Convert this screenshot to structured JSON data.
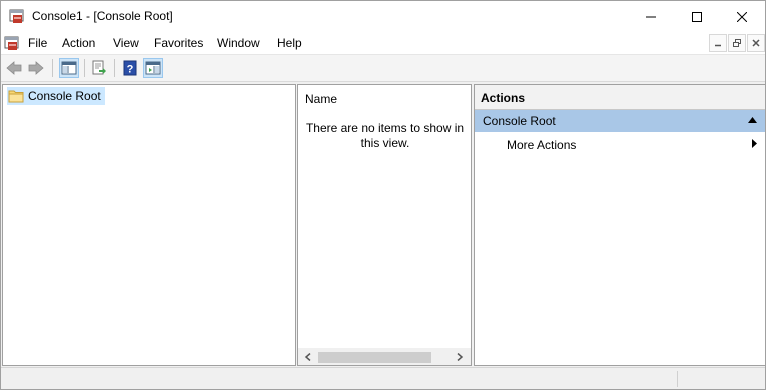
{
  "window": {
    "title": "Console1 - [Console Root]"
  },
  "caption_buttons": {
    "minimize": "minimize-icon",
    "maximize": "maximize-icon",
    "close": "close-icon"
  },
  "menu": {
    "items": [
      {
        "label": "File"
      },
      {
        "label": "Action"
      },
      {
        "label": "View"
      },
      {
        "label": "Favorites"
      },
      {
        "label": "Window"
      },
      {
        "label": "Help"
      }
    ]
  },
  "toolbar": {
    "buttons": [
      "back-arrow-icon",
      "forward-arrow-icon",
      "show-hide-console-tree-icon",
      "export-list-icon",
      "help-icon",
      "show-hide-action-pane-icon"
    ]
  },
  "tree": {
    "root_label": "Console Root"
  },
  "list": {
    "column_header": "Name",
    "empty_message": "There are no items to show in this view."
  },
  "actions": {
    "title": "Actions",
    "group_label": "Console Root",
    "items": [
      {
        "label": "More Actions"
      }
    ]
  },
  "colors": {
    "selection": "#cce8ff",
    "actions_group": "#a9c7e7",
    "toolbar_pressed": "#cde4f7"
  }
}
